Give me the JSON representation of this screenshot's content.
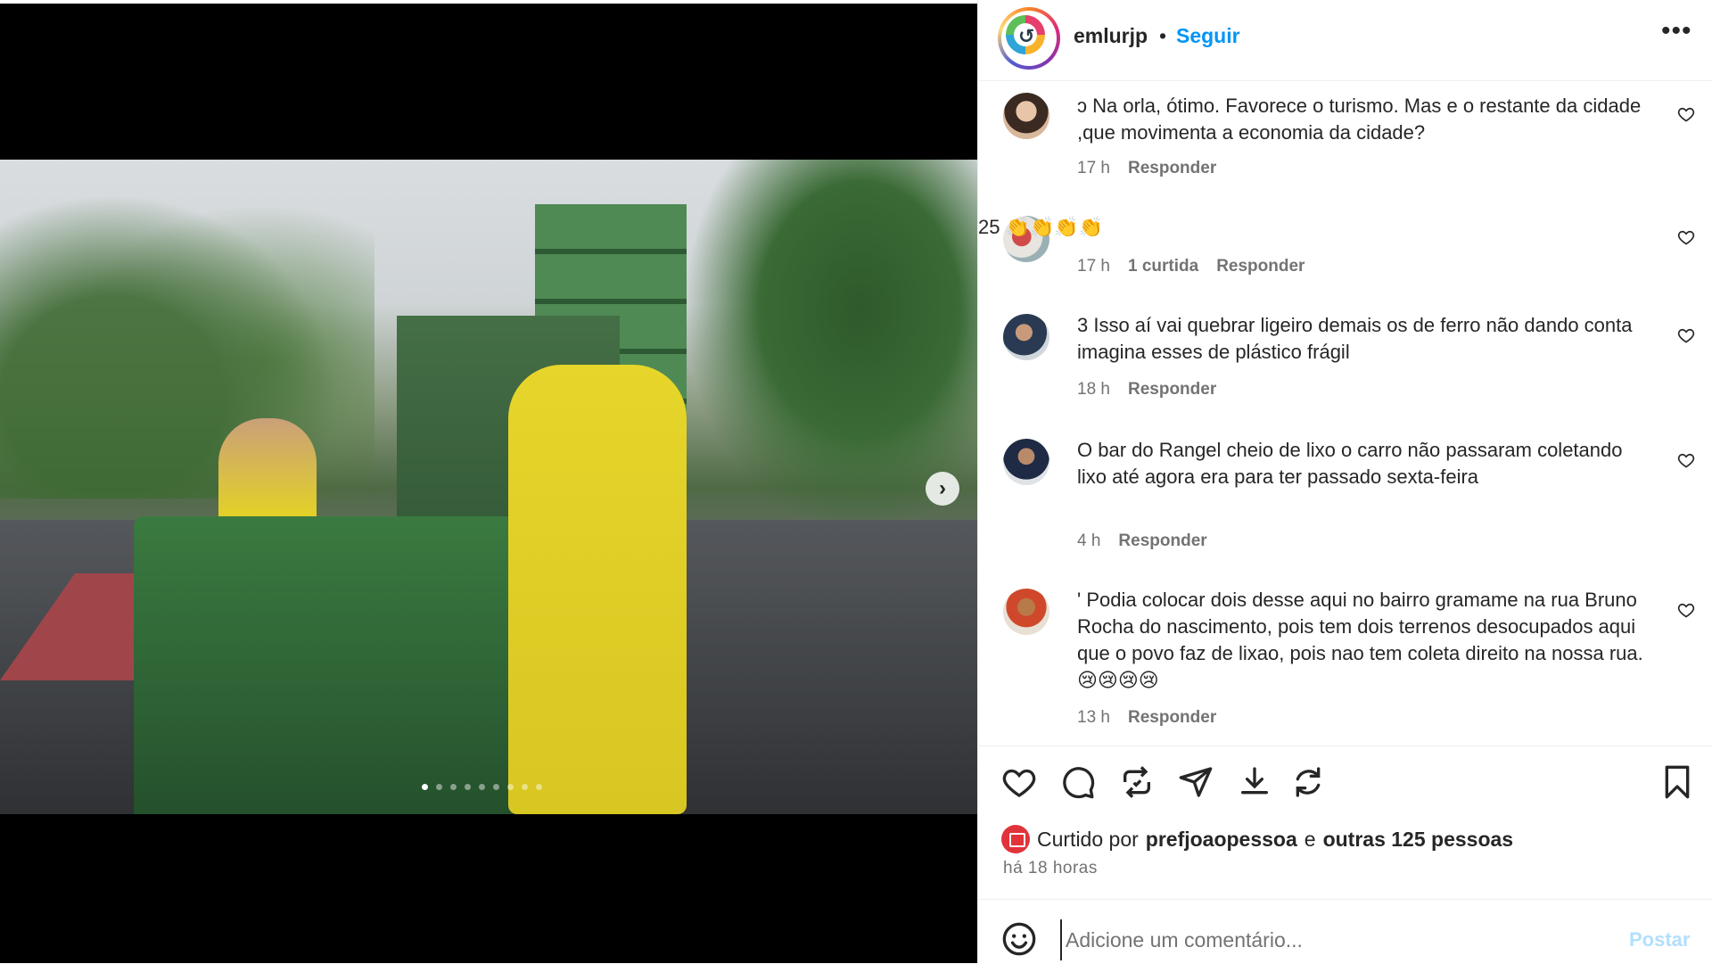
{
  "post": {
    "author": "emlurjp",
    "separator": "•",
    "follow_label": "Seguir",
    "more_icon": "more-options-icon",
    "more_glyph": "•••"
  },
  "media": {
    "next_glyph": "›",
    "slide_count": 9,
    "active_slide": 1
  },
  "comments": [
    {
      "text": "ɔ Na orla, ótimo. Favorece o turismo. Mas e o restante da cidade ,que movimenta a economia da cidade?",
      "time": "17 h",
      "likes": "",
      "reply": "Responder"
    },
    {
      "text": "25 👏👏👏👏",
      "time": "17 h",
      "likes": "1 curtida",
      "reply": "Responder"
    },
    {
      "text": "3 Isso aí vai quebrar ligeiro demais os de ferro não dando conta imagina esses de plástico frágil",
      "time": "18 h",
      "likes": "",
      "reply": "Responder"
    },
    {
      "text": "O bar do Rangel cheio de lixo o carro não passaram coletando lixo até agora era para ter passado sexta-feira",
      "time": "4 h",
      "likes": "",
      "reply": "Responder"
    },
    {
      "text": "' Podia colocar dois desse aqui no bairro gramame na rua Bruno Rocha do nascimento, pois tem dois terrenos desocupados aqui que o povo faz de lixao, pois nao tem coleta direito na nossa rua.😢😢😢😢",
      "time": "13 h",
      "likes": "",
      "reply": "Responder"
    }
  ],
  "likes_line": {
    "prefix": "Curtido por",
    "user": "prefjoaopessoa",
    "conj": "e",
    "others": "outras 125 pessoas"
  },
  "time_ago": "há 18 horas",
  "composer": {
    "placeholder": "Adicione um comentário...",
    "post_label": "Postar"
  },
  "colors": {
    "accent": "#0095f6",
    "post_disabled": "#b2dffc",
    "meta_text": "#737373"
  }
}
